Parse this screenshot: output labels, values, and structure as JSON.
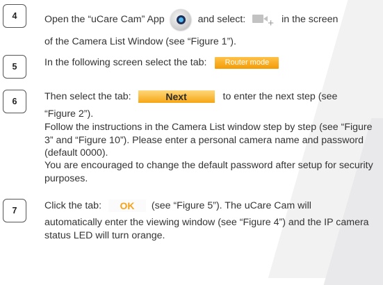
{
  "steps": [
    {
      "number": "4",
      "line1_a": "Open the “uCare Cam” App",
      "line1_b": "and select:",
      "line1_c": "in the screen",
      "line2": "of the Camera List Window (see “Figure 1”).",
      "icons": [
        "ucare-cam-app-icon",
        "camera-add-icon"
      ]
    },
    {
      "number": "5",
      "text": "In the following screen select the tab:",
      "tab_label": "Router mode"
    },
    {
      "number": "6",
      "text_a": "Then select the tab:",
      "tab_label": "Next",
      "text_b": "to enter the next step (see",
      "line2": "“Figure 2”).",
      "para1": "Follow the instructions in the Camera List window step by step (see “Figure 3” and “Figure 10”). Please enter a personal camera name and password (default 0000).",
      "para2": "You are encouraged to change the default password after setup for security purposes."
    },
    {
      "number": "7",
      "text_a": "Click the tab:",
      "tab_label": "OK",
      "text_b": "(see “Figure 5”). The uCare Cam will",
      "para": "automatically enter the viewing window (see “Figure 4”) and the IP camera status LED will turn orange."
    }
  ],
  "colors": {
    "tab_orange": "#f39b06",
    "ok_text": "#f7a21b",
    "text": "#333333"
  }
}
